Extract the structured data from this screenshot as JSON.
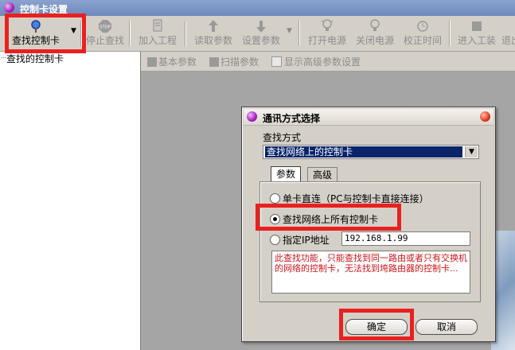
{
  "window": {
    "title": "控制卡设置"
  },
  "toolbar": {
    "items": [
      {
        "label": "查找控制卡",
        "icon": "magnifier-icon"
      },
      {
        "label": "停止查找",
        "icon": "stop-icon"
      },
      {
        "label": "加入工程",
        "icon": "add-project-icon"
      },
      {
        "label": "读取参数",
        "icon": "arrow-up-icon"
      },
      {
        "label": "设置参数",
        "icon": "arrow-down-icon"
      },
      {
        "label": "打开电源",
        "icon": "bulb-on-icon"
      },
      {
        "label": "关闭电源",
        "icon": "bulb-off-icon"
      },
      {
        "label": "校正时间",
        "icon": "clock-icon"
      },
      {
        "label": "进入工装",
        "icon": "tooling-icon"
      },
      {
        "label": "退出",
        "icon": "exit-icon"
      }
    ]
  },
  "tree": {
    "item": "查找的控制卡"
  },
  "subtoolbar": {
    "basic": "基本参数",
    "scan": "扫描参数",
    "advanced": "显示高级参数设置"
  },
  "dialog": {
    "title": "通讯方式选择",
    "find_label": "查找方式",
    "find_value": "查找网络上的控制卡",
    "tabs": [
      "参数",
      "高级"
    ],
    "options": [
      {
        "label": "单卡直连（PC与控制卡直接连接）",
        "checked": false
      },
      {
        "label": "查找网络上所有控制卡",
        "checked": true
      },
      {
        "label": "指定IP地址",
        "checked": false
      }
    ],
    "ip_value": "192.168.1.99",
    "note": "此查找功能，只能查找到同一路由或者只有交换机的网络的控制卡，无法找到垮路由器的控制卡...",
    "ok": "确定",
    "cancel": "取消"
  },
  "colors": {
    "highlight": "#e8211f",
    "note_text": "#d0141a",
    "selection": "#0a246a"
  }
}
